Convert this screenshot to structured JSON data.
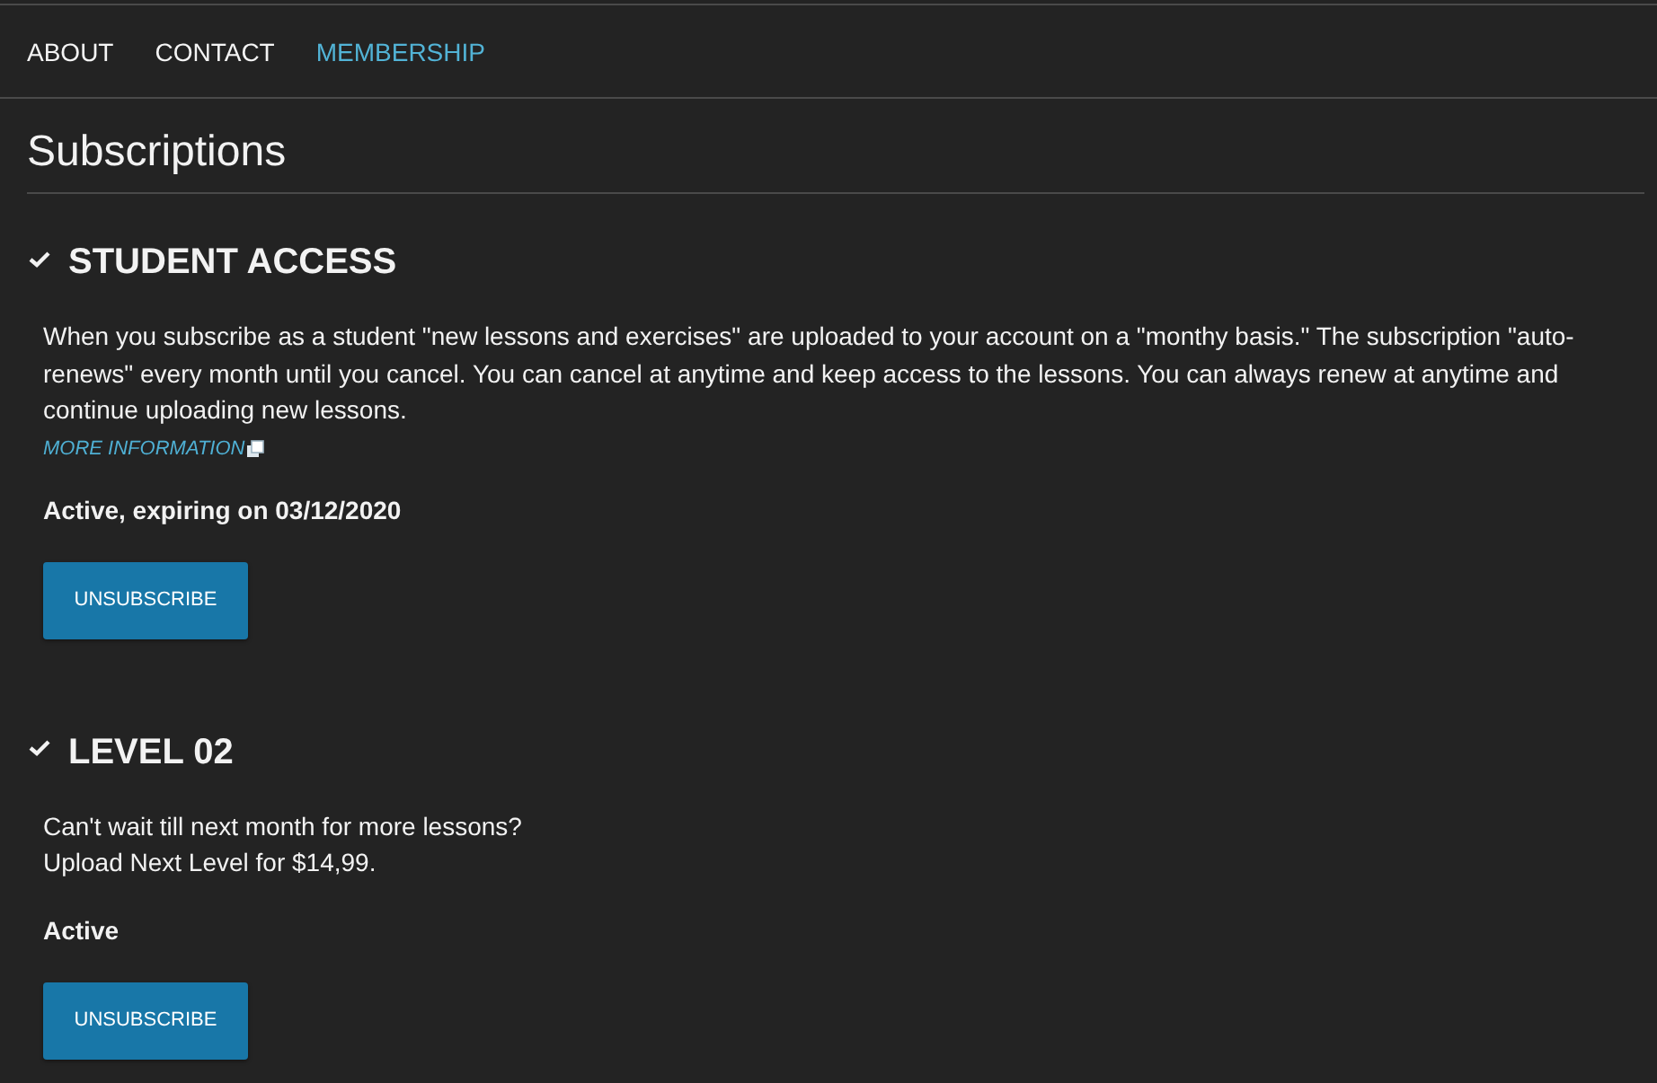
{
  "nav": {
    "items": [
      {
        "label": "ABOUT",
        "selected": false
      },
      {
        "label": "CONTACT",
        "selected": false
      },
      {
        "label": "MEMBERSHIP",
        "selected": true
      }
    ]
  },
  "page_title": "Subscriptions",
  "subscriptions": [
    {
      "name": "STUDENT ACCESS",
      "description": [
        "When you subscribe as a student \"new lessons and exercises\" are uploaded to your account on a \"monthy basis.\" The subscription \"auto-renews\" every month until you cancel. You can cancel at anytime and keep access to the lessons. You can always renew at anytime and continue uploading new lessons."
      ],
      "link": "MORE INFORMATION",
      "status": "Active, expiring on 03/12/2020",
      "button": "UNSUBSCRIBE"
    },
    {
      "name": "LEVEL 02",
      "description": [
        "Can't wait till next month for more lessons?",
        "Upload Next Level for $14,99."
      ],
      "status": "Active",
      "button": "UNSUBSCRIBE"
    }
  ]
}
